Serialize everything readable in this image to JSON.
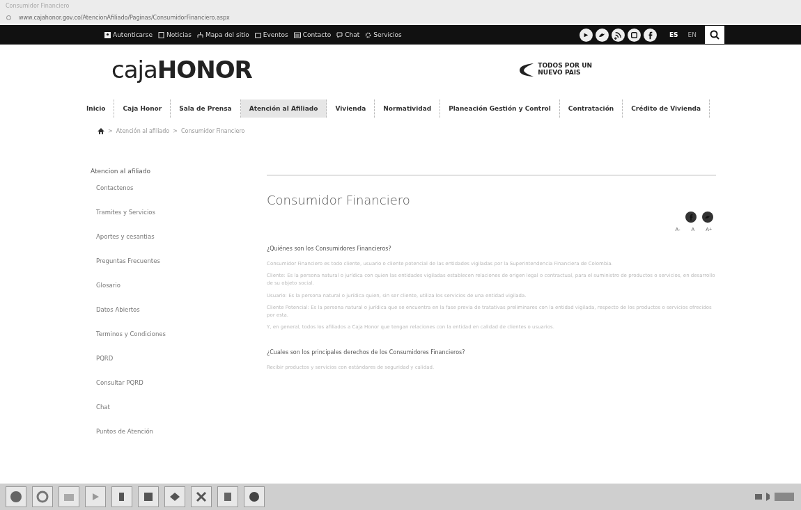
{
  "browser": {
    "tab_title": "Consumidor Financiero",
    "url": "www.cajahonor.gov.co/AtencionAfiliado/Paginas/ConsumidorFinanciero.aspx"
  },
  "topbar": {
    "links": [
      {
        "label": "Autenticarse"
      },
      {
        "label": "Noticias"
      },
      {
        "label": "Mapa del sitio"
      },
      {
        "label": "Eventos"
      },
      {
        "label": "Contacto"
      },
      {
        "label": "Chat"
      },
      {
        "label": "Servicios"
      }
    ],
    "languages": [
      {
        "label": "ES",
        "selected": true
      },
      {
        "label": "EN",
        "selected": false
      }
    ]
  },
  "header": {
    "logo": "caja**HONOR**",
    "gov_logo": [
      "TODOS POR UN",
      "NUEVO PAIS"
    ]
  },
  "nav": [
    {
      "label": "Inicio",
      "selected": false
    },
    {
      "label": "Caja Honor",
      "selected": false
    },
    {
      "label": "Sala de Prensa",
      "selected": false
    },
    {
      "label": "Atención al Afiliado",
      "selected": true
    },
    {
      "label": "Vivienda",
      "selected": false
    },
    {
      "label": "Normatividad",
      "selected": false
    },
    {
      "label": "Planeación Gestión y Control",
      "selected": false
    },
    {
      "label": "Contratación",
      "selected": false
    },
    {
      "label": "Crédito de Vivienda",
      "selected": false
    }
  ],
  "breadcrumb": [
    {
      "separator": ">",
      "label": "Atención al afiliado"
    },
    {
      "separator": ">",
      "label": "Consumidor Financiero"
    }
  ],
  "sidebar": {
    "title": "Atencion al afiliado",
    "items": [
      "Contactenos",
      "Tramites y Servicios",
      "Aportes y cesantias",
      "Preguntas Frecuentes",
      "Glosario",
      "Datos Abiertos",
      "Terminos y Condiciones",
      "PQRD",
      "Consultar PQRD",
      "Chat",
      "Puntos de Atención"
    ]
  },
  "content": {
    "title": "Consumidor Financiero",
    "font_controls": [
      "A-",
      "A",
      "A+"
    ],
    "sections": [
      {
        "heading": "¿Quiénes son los Consumidores Financieros?",
        "paragraphs": [
          "Consumidor Financiero es todo cliente, usuario o cliente potencial de las entidades vigiladas por la Superintendencia Financiera de Colombia.",
          "Cliente: Es la persona natural o jurídica con quien las entidades vigiladas establecen relaciones de origen legal o contractual, para el suministro de productos o servicios, en desarrollo de su objeto social.",
          "Usuario: Es la persona natural o jurídica quien, sin ser cliente, utiliza los servicios de una entidad vigilada.",
          "Cliente Potencial: Es la persona natural o jurídica que se encuentra en la fase previa de tratativas preliminares con la entidad vigilada, respecto de los productos o servicios ofrecidos por esta.",
          "Y, en general, todos los afiliados a Caja Honor que tengan relaciones con la entidad en calidad de clientes o usuarios."
        ]
      },
      {
        "heading": "¿Cuales son los principales derechos de los Consumidores Financieros?",
        "paragraphs": [
          "Recibir productos y servicios con estándares de seguridad y calidad."
        ]
      }
    ]
  }
}
